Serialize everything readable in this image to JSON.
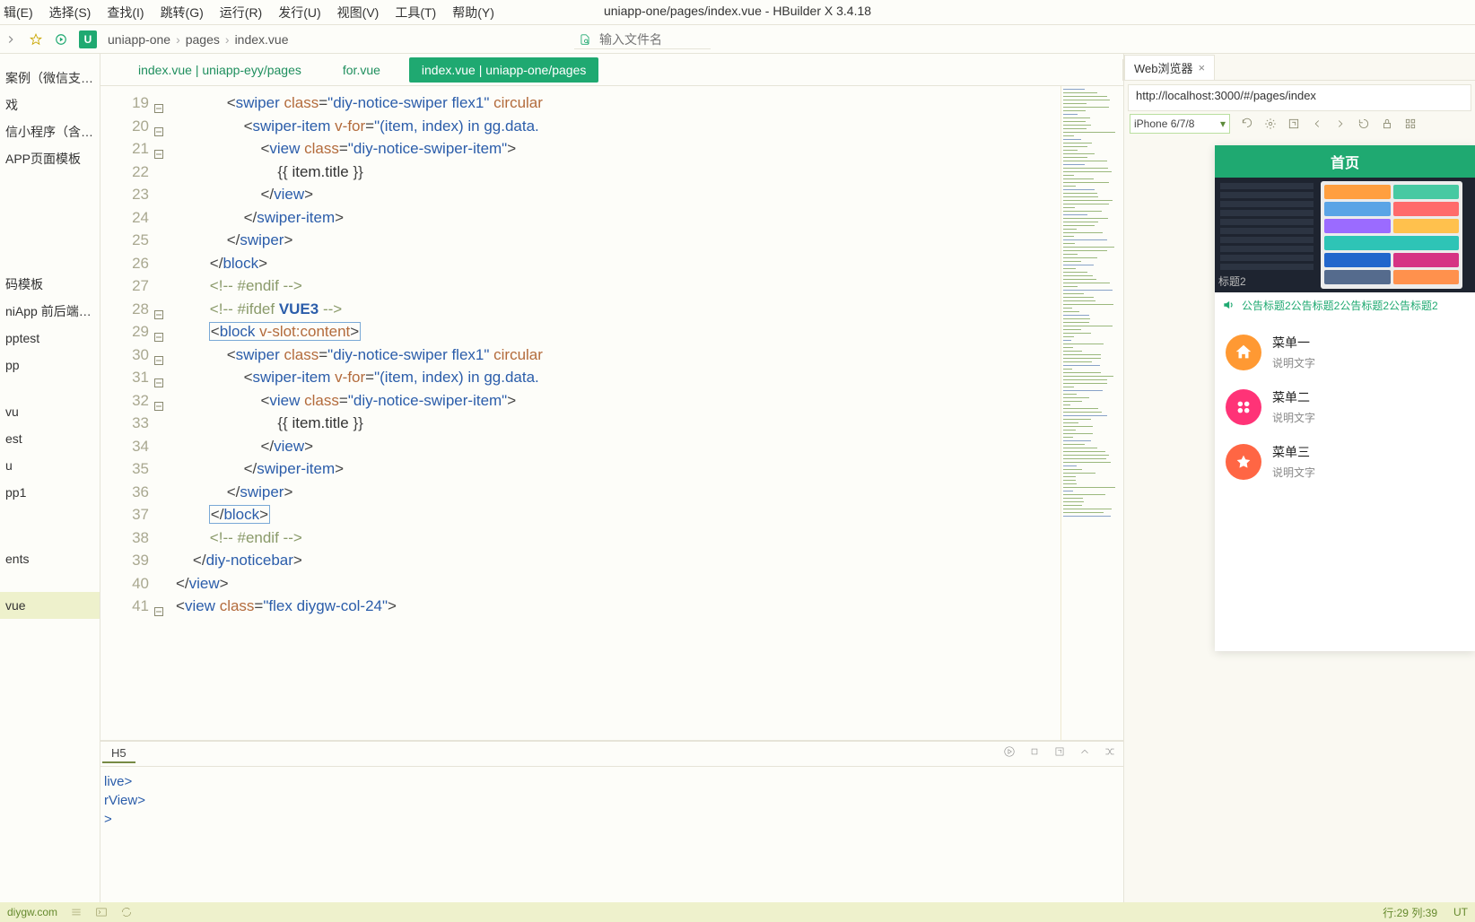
{
  "app": {
    "title_path": "uniapp-one/pages/index.vue",
    "title_app": "HBuilder X 3.4.18"
  },
  "menu": [
    "辑(E)",
    "选择(S)",
    "查找(I)",
    "跳转(G)",
    "运行(R)",
    "发行(U)",
    "视图(V)",
    "工具(T)",
    "帮助(Y)"
  ],
  "breadcrumb": [
    "uniapp-one",
    "pages",
    "index.vue"
  ],
  "file_search_placeholder": "输入文件名",
  "sidebar": {
    "items": [
      "案例（微信支付、...",
      "戏",
      "信小程序（含后端...",
      "APP页面模板",
      "",
      "",
      "",
      "",
      "",
      "码模板",
      "niApp 前后端开...",
      "pptest",
      "pp",
      "",
      "vu",
      "est",
      "u",
      "pp1",
      "",
      "",
      "ents",
      "",
      "vue"
    ],
    "selected": "vue"
  },
  "tabs": [
    {
      "label": "index.vue | uniapp-eyy/pages",
      "active": false
    },
    {
      "label": "for.vue",
      "active": false
    },
    {
      "label": "index.vue | uniapp-one/pages",
      "active": true
    }
  ],
  "editor": {
    "lines": [
      {
        "n": 19,
        "fold": true,
        "html": "            <span class='tok-op'>&lt;</span><span class='tok-tag'>swiper</span> <span class='tok-attr'>class</span><span class='tok-op'>=</span><span class='tok-str'>\"diy-notice-swiper flex1\"</span> <span class='tok-attr'>circular</span>"
      },
      {
        "n": 20,
        "fold": true,
        "html": "                <span class='tok-op'>&lt;</span><span class='tok-tag'>swiper-item</span> <span class='tok-attr'>v-for</span><span class='tok-op'>=</span><span class='tok-str'>\"(item, index) in gg.data.</span>"
      },
      {
        "n": 21,
        "fold": true,
        "html": "                    <span class='tok-op'>&lt;</span><span class='tok-tag'>view</span> <span class='tok-attr'>class</span><span class='tok-op'>=</span><span class='tok-str'>\"diy-notice-swiper-item\"</span><span class='tok-op'>&gt;</span>"
      },
      {
        "n": 22,
        "html": "                        <span class='tok-op'>{{</span> item.title <span class='tok-op'>}}</span>"
      },
      {
        "n": 23,
        "html": "                    <span class='tok-op'>&lt;/</span><span class='tok-tag'>view</span><span class='tok-op'>&gt;</span>"
      },
      {
        "n": 24,
        "html": "                <span class='tok-op'>&lt;/</span><span class='tok-tag'>swiper-item</span><span class='tok-op'>&gt;</span>"
      },
      {
        "n": 25,
        "html": "            <span class='tok-op'>&lt;/</span><span class='tok-tag'>swiper</span><span class='tok-op'>&gt;</span>"
      },
      {
        "n": 26,
        "html": "        <span class='tok-op'>&lt;/</span><span class='tok-tag'>block</span><span class='tok-op'>&gt;</span>"
      },
      {
        "n": 27,
        "html": "        <span class='tok-comment'>&lt;!-- #endif --&gt;</span>"
      },
      {
        "n": 28,
        "fold": true,
        "html": "        <span class='tok-comment'>&lt;!-- #ifdef </span><span class='tok-key'>VUE3</span><span class='tok-comment'> --&gt;</span>"
      },
      {
        "n": 29,
        "fold": true,
        "html": "        <span class='hl-box'><span class='tok-op'>&lt;</span><span class='tok-tag'>block</span> <span class='tok-attr'>v-slot:content</span><span class='tok-op'>&gt;</span></span>"
      },
      {
        "n": 30,
        "fold": true,
        "html": "            <span class='tok-op'>&lt;</span><span class='tok-tag'>swiper</span> <span class='tok-attr'>class</span><span class='tok-op'>=</span><span class='tok-str'>\"diy-notice-swiper flex1\"</span> <span class='tok-attr'>circular</span>"
      },
      {
        "n": 31,
        "fold": true,
        "html": "                <span class='tok-op'>&lt;</span><span class='tok-tag'>swiper-item</span> <span class='tok-attr'>v-for</span><span class='tok-op'>=</span><span class='tok-str'>\"(item, index) in gg.data.</span>"
      },
      {
        "n": 32,
        "fold": true,
        "html": "                    <span class='tok-op'>&lt;</span><span class='tok-tag'>view</span> <span class='tok-attr'>class</span><span class='tok-op'>=</span><span class='tok-str'>\"diy-notice-swiper-item\"</span><span class='tok-op'>&gt;</span>"
      },
      {
        "n": 33,
        "html": "                        <span class='tok-op'>{{</span> item.title <span class='tok-op'>}}</span>"
      },
      {
        "n": 34,
        "html": "                    <span class='tok-op'>&lt;/</span><span class='tok-tag'>view</span><span class='tok-op'>&gt;</span>"
      },
      {
        "n": 35,
        "html": "                <span class='tok-op'>&lt;/</span><span class='tok-tag'>swiper-item</span><span class='tok-op'>&gt;</span>"
      },
      {
        "n": 36,
        "html": "            <span class='tok-op'>&lt;/</span><span class='tok-tag'>swiper</span><span class='tok-op'>&gt;</span>"
      },
      {
        "n": 37,
        "html": "        <span class='hl-box'><span class='tok-op'>&lt;/</span><span class='tok-tag'>block</span><span class='tok-op'>&gt;</span></span>"
      },
      {
        "n": 38,
        "html": "        <span class='tok-comment'>&lt;!-- #endif --&gt;</span>"
      },
      {
        "n": 39,
        "html": "    <span class='tok-op'>&lt;/</span><span class='tok-tag'>diy-noticebar</span><span class='tok-op'>&gt;</span>"
      },
      {
        "n": 40,
        "html": "<span class='tok-op'>&lt;/</span><span class='tok-tag'>view</span><span class='tok-op'>&gt;</span>"
      },
      {
        "n": 41,
        "fold": true,
        "html": "<span class='tok-op'>&lt;</span><span class='tok-tag'>view</span> <span class='tok-attr'>class</span><span class='tok-op'>=</span><span class='tok-str'>\"flex diygw-col-24\"</span><span class='tok-op'>&gt;</span>"
      }
    ]
  },
  "console": {
    "tab": "H5",
    "lines": [
      "live>",
      "rView>",
      ">"
    ]
  },
  "browser": {
    "tab_label": "Web浏览器",
    "url": "http://localhost:3000/#/pages/index",
    "device": "iPhone 6/7/8"
  },
  "preview": {
    "header": "首页",
    "banner_label": "标题2",
    "notice": "公告标题2公告标题2公告标题2公告标题2",
    "menus": [
      {
        "title": "菜单一",
        "sub": "说明文字",
        "color": "#ff9933"
      },
      {
        "title": "菜单二",
        "sub": "说明文字",
        "color": "#ff3377"
      },
      {
        "title": "菜单三",
        "sub": "说明文字",
        "color": "#ff6644"
      }
    ]
  },
  "status": {
    "link": "diygw.com",
    "cursor": "行:29  列:39",
    "encoding": "UT"
  }
}
